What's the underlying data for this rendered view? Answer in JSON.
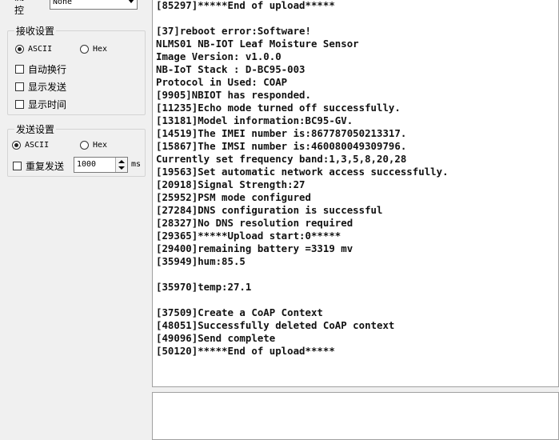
{
  "flow_control": {
    "label": "流 控",
    "value": "None"
  },
  "receive_settings": {
    "title": "接收设置",
    "ascii_label": "ASCII",
    "hex_label": "Hex",
    "auto_wrap_label": "自动换行",
    "show_send_label": "显示发送",
    "show_time_label": "显示时间"
  },
  "send_settings": {
    "title": "发送设置",
    "ascii_label": "ASCII",
    "hex_label": "Hex",
    "repeat_send_label": "重复发送",
    "interval_value": "1000",
    "interval_unit": "ms"
  },
  "receive_area": {
    "lines": [
      "[85297]*****End of upload*****",
      "",
      "[37]reboot error:Software!",
      "NLMS01 NB-IOT Leaf Moisture Sensor",
      "Image Version: v1.0.0",
      "NB-IoT Stack : D-BC95-003",
      "Protocol in Used: COAP",
      "[9905]NBIOT has responded.",
      "[11235]Echo mode turned off successfully.",
      "[13181]Model information:BC95-GV.",
      "[14519]The IMEI number is:867787050213317.",
      "[15867]The IMSI number is:460080049309796.",
      "Currently set frequency band:1,3,5,8,20,28",
      "[19563]Set automatic network access successfully.",
      "[20918]Signal Strength:27",
      "[25952]PSM mode configured",
      "[27284]DNS configuration is successful",
      "[28327]No DNS resolution required",
      "[29365]*****Upload start:0*****",
      "[29400]remaining battery =3319 mv",
      "[35949]hum:85.5",
      "",
      "[35970]temp:27.1",
      "",
      "[37509]Create a CoAP Context",
      "[48051]Successfully deleted CoAP context",
      "[49096]Send complete",
      "[50120]*****End of upload*****"
    ]
  },
  "send_area": {
    "value": ""
  }
}
